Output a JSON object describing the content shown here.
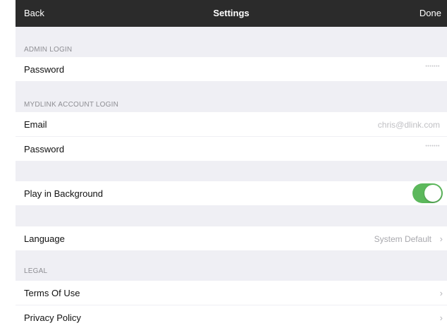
{
  "navbar": {
    "back_label": "Back",
    "title": "Settings",
    "done_label": "Done"
  },
  "admin_login": {
    "header": "ADMIN LOGIN",
    "password_label": "Password",
    "password_value": "•••••••"
  },
  "mydlink_login": {
    "header": "MYDLINK ACCOUNT LOGIN",
    "email_label": "Email",
    "email_value": "chris@dlink.com",
    "password_label": "Password",
    "password_value": "•••••••"
  },
  "background": {
    "label": "Play in Background",
    "enabled": true
  },
  "language": {
    "label": "Language",
    "value": "System Default"
  },
  "legal": {
    "header": "LEGAL",
    "items": [
      {
        "label": "Terms Of Use"
      },
      {
        "label": "Privacy Policy"
      }
    ]
  },
  "icons": {
    "chevron": "chevron-right-icon"
  },
  "colors": {
    "navbar_bg": "#2b2b2b",
    "group_bg": "#efeff4",
    "toggle_on": "#5cb85c"
  }
}
